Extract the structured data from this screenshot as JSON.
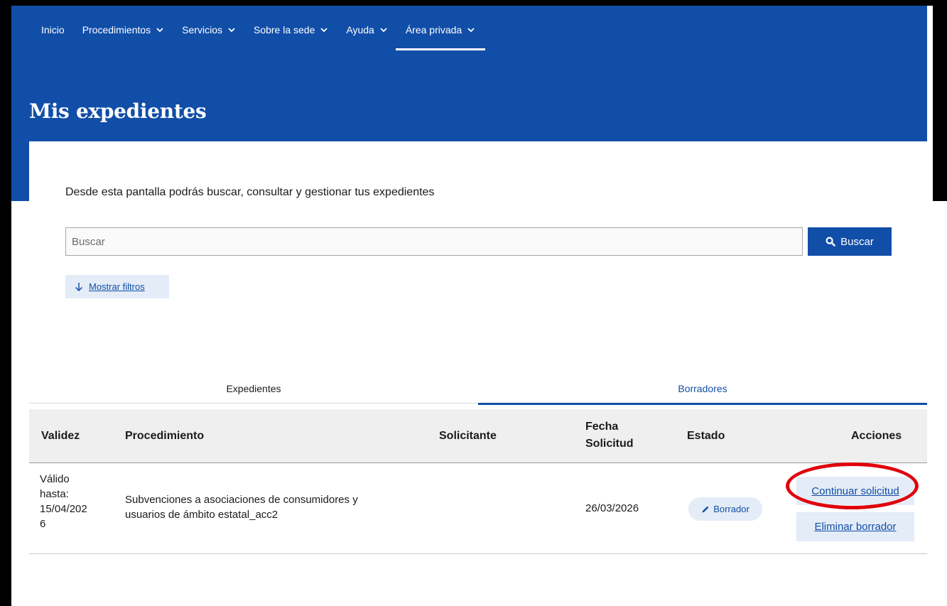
{
  "nav": {
    "items": [
      {
        "label": "Inicio",
        "has_menu": false
      },
      {
        "label": "Procedimientos",
        "has_menu": true
      },
      {
        "label": "Servicios",
        "has_menu": true
      },
      {
        "label": "Sobre la sede",
        "has_menu": true
      },
      {
        "label": "Ayuda",
        "has_menu": true
      },
      {
        "label": "Área privada",
        "has_menu": true,
        "active": true
      }
    ]
  },
  "header": {
    "title": "Mis expedientes"
  },
  "intro": "Desde esta pantalla podrás buscar, consultar y gestionar tus expedientes",
  "search": {
    "placeholder": "Buscar",
    "value": "",
    "button_label": "Buscar",
    "button_icon": "search-icon"
  },
  "filters": {
    "label": "Mostrar filtros",
    "icon": "arrow-down-icon"
  },
  "tabs": [
    {
      "label": "Expedientes",
      "active": false
    },
    {
      "label": "Borradores",
      "active": true
    }
  ],
  "table": {
    "columns": {
      "validez": "Validez",
      "procedimiento": "Procedimiento",
      "solicitante": "Solicitante",
      "fecha_line1": "Fecha",
      "fecha_line2": "Solicitud",
      "estado": "Estado",
      "acciones": "Acciones"
    },
    "rows": [
      {
        "validez": [
          "Válido",
          "hasta:",
          "15/04/202",
          "6"
        ],
        "procedimiento": [
          "Subvenciones a asociaciones de consumidores y",
          "usuarios de ámbito estatal_acc2"
        ],
        "solicitante": "",
        "fecha": "26/03/2026",
        "estado": {
          "label": "Borrador",
          "icon": "pencil-icon"
        },
        "acciones": [
          "Continuar solicitud",
          "Eliminar borrador"
        ]
      }
    ]
  },
  "annotation": {
    "color": "#e0000b",
    "target": "Continuar solicitud"
  },
  "colors": {
    "primary": "#114ea8",
    "light_primary": "#e4ecf7",
    "header_bg": "#efefef"
  }
}
